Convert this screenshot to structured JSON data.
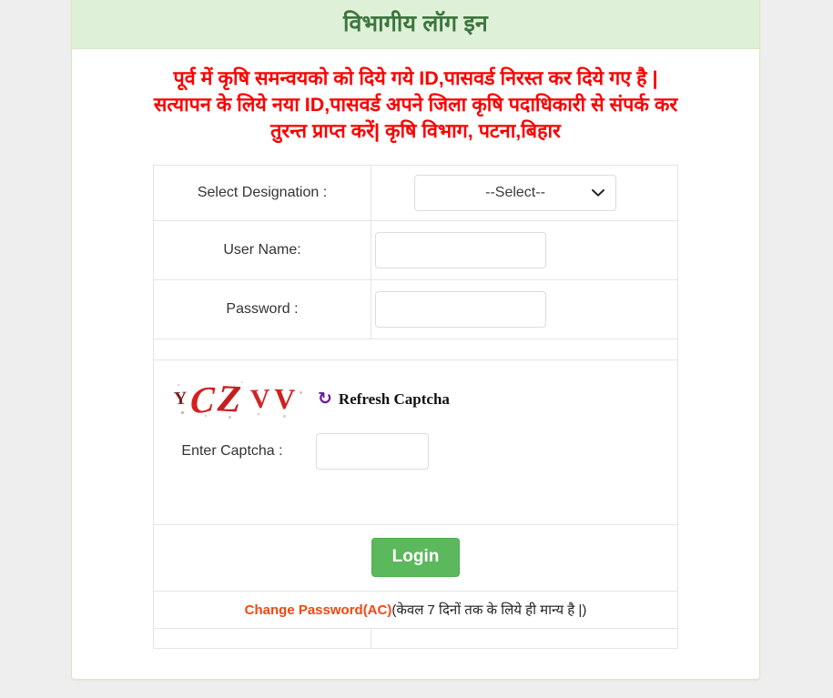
{
  "panel": {
    "title": "विभागीय लॉग इन",
    "header_bg": "#dff0d8",
    "title_color": "#3c763d"
  },
  "notice": {
    "color": "#fa0000",
    "line1": "पूर्व में कृषि समन्वयको को दिये गये ID,पासवर्ड निरस्त कर दिये गए है |",
    "line2": "सत्यापन के लिये नया ID,पासवर्ड अपने जिला कृषि पदाधिकारी से संपर्क कर",
    "line3": "तुरन्त प्राप्त करें| कृषि विभाग, पटना,बिहार"
  },
  "form": {
    "designation": {
      "label": "Select Designation :",
      "selected": "--Select--",
      "options": [
        "--Select--"
      ]
    },
    "username": {
      "label": "User Name:",
      "value": "",
      "placeholder": ""
    },
    "password": {
      "label": "Password :",
      "value": "",
      "placeholder": ""
    },
    "captcha": {
      "text": "YCZVV",
      "chars": [
        "Y",
        "C",
        "Z",
        "V",
        "V"
      ],
      "refresh_label": "Refresh Captcha",
      "refresh_icon": "refresh-icon",
      "entry_label": "Enter Captcha :",
      "entry_value": "",
      "entry_placeholder": ""
    },
    "login_button": {
      "label": "Login",
      "color": "#5cb85c"
    },
    "change_password": {
      "link_label": "Change Password(AC)",
      "link_color": "#f4460f",
      "note": "(केवल 7 दिनों तक के लिये ही मान्य है |)"
    }
  }
}
